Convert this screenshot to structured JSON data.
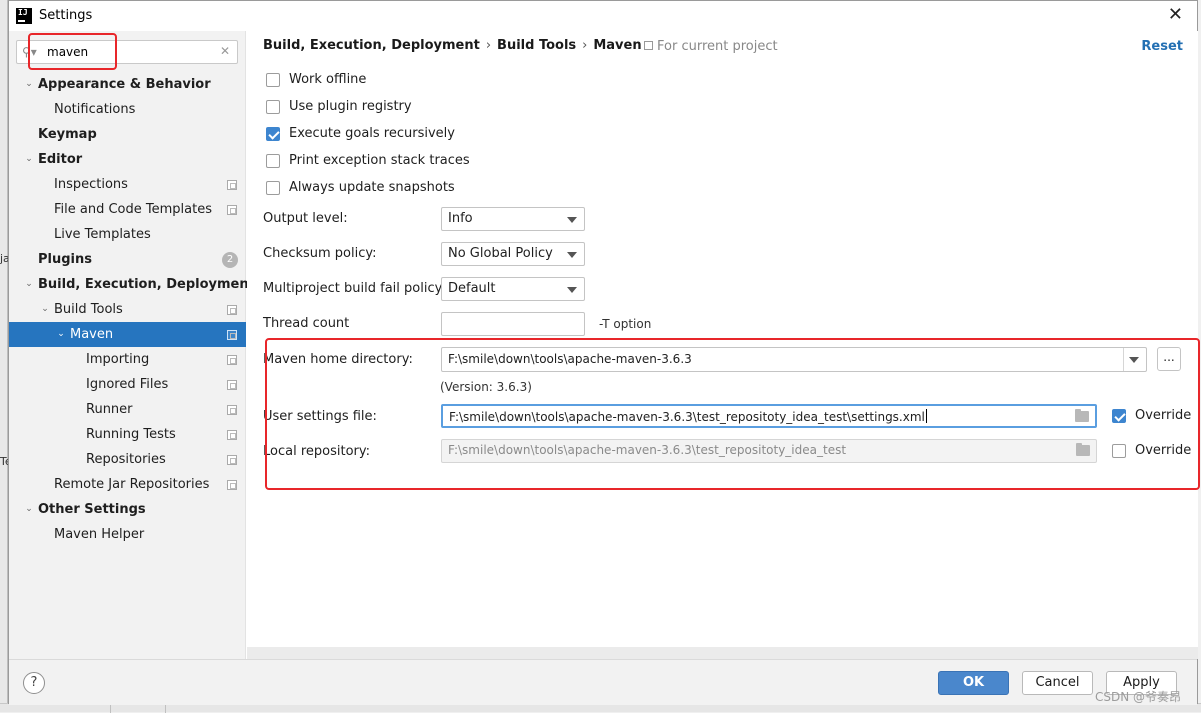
{
  "window": {
    "title": "Settings",
    "app_icon_text": "IJ"
  },
  "search": {
    "value": "maven"
  },
  "tree": {
    "items": [
      {
        "label": "Appearance & Behavior"
      },
      {
        "label": "Notifications"
      },
      {
        "label": "Keymap"
      },
      {
        "label": "Editor"
      },
      {
        "label": "Inspections"
      },
      {
        "label": "File and Code Templates"
      },
      {
        "label": "Live Templates"
      },
      {
        "label": "Plugins",
        "badge": "2"
      },
      {
        "label": "Build, Execution, Deployment"
      },
      {
        "label": "Build Tools"
      },
      {
        "label": "Maven"
      },
      {
        "label": "Importing"
      },
      {
        "label": "Ignored Files"
      },
      {
        "label": "Runner"
      },
      {
        "label": "Running Tests"
      },
      {
        "label": "Repositories"
      },
      {
        "label": "Remote Jar Repositories"
      },
      {
        "label": "Other Settings"
      },
      {
        "label": "Maven Helper"
      }
    ]
  },
  "breadcrumb": {
    "part1": "Build, Execution, Deployment",
    "part2": "Build Tools",
    "part3": "Maven",
    "separator": "›"
  },
  "header": {
    "for_project": "For current project",
    "reset": "Reset"
  },
  "checkboxes": {
    "work_offline": {
      "label": "Work offline",
      "checked": false
    },
    "use_plugin_registry": {
      "label": "Use plugin registry",
      "checked": false
    },
    "execute_goals": {
      "label": "Execute goals recursively",
      "checked": true
    },
    "print_exception": {
      "label": "Print exception stack traces",
      "checked": false
    },
    "always_update": {
      "label": "Always update snapshots",
      "checked": false
    }
  },
  "fields": {
    "output_level": {
      "label": "Output level:",
      "value": "Info"
    },
    "checksum_policy": {
      "label": "Checksum policy:",
      "value": "No Global Policy"
    },
    "multiproject_fail": {
      "label": "Multiproject build fail policy:",
      "value": "Default"
    },
    "thread_count": {
      "label": "Thread count",
      "value": "",
      "hint": "-T option"
    },
    "maven_home": {
      "label": "Maven home directory:",
      "value": "F:\\smile\\down\\tools\\apache-maven-3.6.3",
      "version": "(Version: 3.6.3)",
      "browse": "..."
    },
    "user_settings": {
      "label": "User settings file:",
      "value": "F:\\smile\\down\\tools\\apache-maven-3.6.3\\test_repositoty_idea_test\\settings.xml",
      "override_label": "Override",
      "override_checked": true
    },
    "local_repo": {
      "label": "Local repository:",
      "value": "F:\\smile\\down\\tools\\apache-maven-3.6.3\\test_repositoty_idea_test",
      "override_label": "Override",
      "override_checked": false
    }
  },
  "footer": {
    "help": "?",
    "ok": "OK",
    "cancel": "Cancel",
    "apply": "Apply",
    "watermark": "CSDN @爷奏昂"
  },
  "background": {
    "glyph1": "ja",
    "glyph2": "Te"
  },
  "colors": {
    "selection": "#2675bf",
    "primary_button": "#4a87cc",
    "annotation_red": "#e8262a",
    "link": "#2470b3"
  }
}
